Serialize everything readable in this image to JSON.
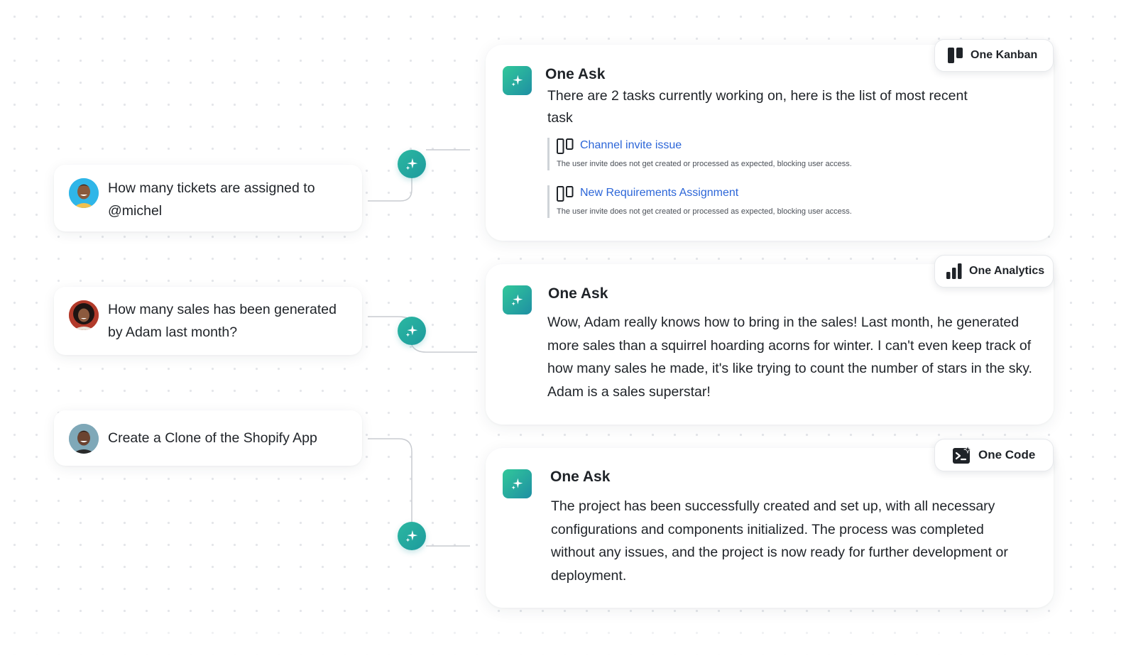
{
  "questions": [
    {
      "avatar_icon": "user-avatar-icon",
      "text": "How many tickets are assigned to @michel"
    },
    {
      "avatar_icon": "user-avatar-icon",
      "text": "How many sales has been generated by Adam last month?"
    },
    {
      "avatar_icon": "user-avatar-icon",
      "text": "Create a Clone of the Shopify App"
    }
  ],
  "answers": [
    {
      "title": "One Ask",
      "tag": "One Kanban",
      "tag_icon": "kanban-icon",
      "body": "There are 2 tasks currently working on, here is the list of most recent task",
      "tasks": [
        {
          "title": "Channel invite issue",
          "description": "The user invite does not get created or processed as expected, blocking user access."
        },
        {
          "title": "New Requirements Assignment",
          "description": "The user invite does not get created or processed as expected, blocking user access."
        }
      ]
    },
    {
      "title": "One Ask",
      "tag": "One Analytics",
      "tag_icon": "bar-chart-icon",
      "body": "Wow, Adam really knows how to bring in the sales! Last month, he generated more sales than a squirrel hoarding acorns for winter. I can't even keep track of how many sales he made, it's like trying to count the number of stars in the sky. Adam is a sales superstar!"
    },
    {
      "title": "One Ask",
      "tag": "One Code",
      "tag_icon": "code-icon",
      "body": "The project has been successfully created and set up, with all necessary configurations and components initialized. The process was completed without any issues, and the project is now ready for further development or deployment."
    }
  ],
  "colors": {
    "accent_teal": "#1d9a9e",
    "accent_green": "#32c89a",
    "link_blue": "#2c66d8",
    "text": "#1f2328"
  }
}
